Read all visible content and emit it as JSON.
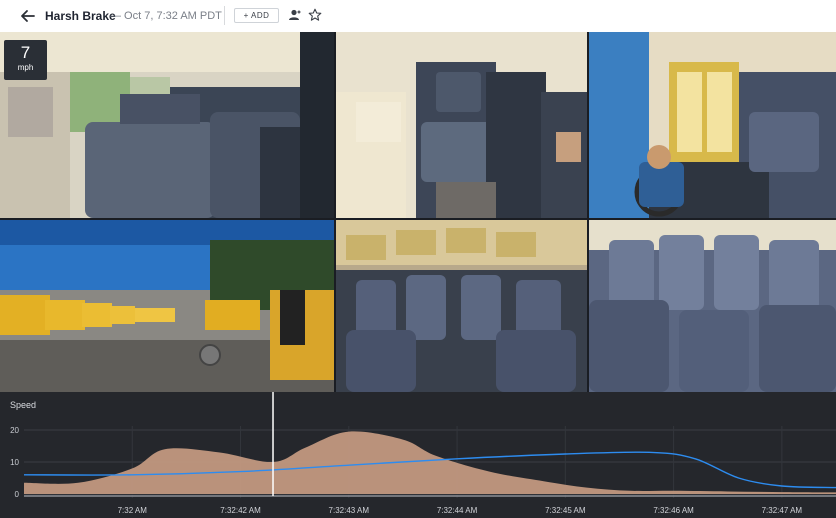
{
  "header": {
    "title": "Harsh Brake",
    "subtitle": "— Oct 7, 7:32 AM PDT",
    "add_label": "+ ADD"
  },
  "overlay": {
    "speed_value": "7",
    "speed_unit": "mph"
  },
  "cameras": [
    {
      "view": "rear-interior-left"
    },
    {
      "view": "interior-aisle"
    },
    {
      "view": "driver-seat"
    },
    {
      "view": "exterior-front-lot"
    },
    {
      "view": "interior-wide-left"
    },
    {
      "view": "interior-wide-right"
    }
  ],
  "colors": {
    "chart_bg": "#25272c",
    "area_fill": "#c79b82",
    "line": "#2d8cf0",
    "cursor": "#ffffff"
  },
  "chart_data": {
    "type": "area",
    "title": "Speed",
    "y_ticks": [
      "20",
      "10",
      "0"
    ],
    "ylim": [
      0,
      22
    ],
    "x_ticks": [
      "7:32 AM",
      "7:32:42 AM",
      "7:32:43 AM",
      "7:32:44 AM",
      "7:32:45 AM",
      "7:32:46 AM",
      "7:32:47 AM"
    ],
    "xlim": [
      0,
      7.5
    ],
    "cursor_x": 2.3,
    "series": [
      {
        "kind": "area",
        "x": [
          0,
          0.5,
          1.0,
          1.3,
          1.8,
          2.3,
          2.6,
          3.0,
          3.5,
          3.8,
          4.3,
          4.8,
          5.2,
          5.6,
          6.0,
          6.5,
          7.0,
          7.5
        ],
        "values": [
          3.5,
          3.5,
          8,
          14,
          13,
          10,
          14.5,
          19.5,
          17,
          12,
          7,
          4,
          2,
          1,
          1,
          0.8,
          0.6,
          0.5
        ]
      },
      {
        "kind": "line",
        "x": [
          0,
          1.0,
          2.0,
          3.0,
          4.0,
          5.0,
          5.8,
          6.2,
          6.6,
          7.0,
          7.5
        ],
        "values": [
          6,
          6,
          7,
          9,
          11,
          12.5,
          13,
          11,
          5,
          2.5,
          2
        ]
      }
    ]
  }
}
